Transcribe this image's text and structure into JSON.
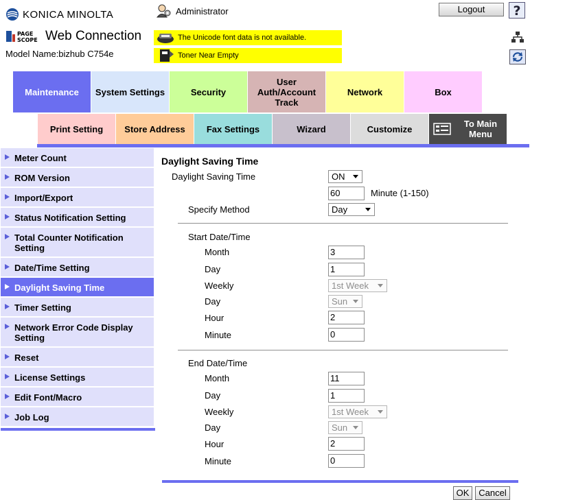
{
  "header": {
    "brand": "KONICA MINOLTA",
    "product": "Web Connection",
    "model_line": "Model Name:bizhub C754e",
    "user": "Administrator",
    "logout_label": "Logout",
    "help_label": "?",
    "messages": [
      "The Unicode font data is not available.",
      "Toner Near Empty"
    ]
  },
  "tabs_row1": [
    {
      "label": "Maintenance",
      "color": "#6b6ef0",
      "active": true
    },
    {
      "label": "System Settings",
      "color": "#d8e6fb"
    },
    {
      "label": "Security",
      "color": "#ccff99"
    },
    {
      "label": "User Auth/Account Track",
      "color": "#d6b4b4"
    },
    {
      "label": "Network",
      "color": "#ffff99"
    },
    {
      "label": "Box",
      "color": "#ffccff"
    }
  ],
  "tabs_row2": [
    {
      "label": "Print Setting",
      "color": "#ffcccc"
    },
    {
      "label": "Store Address",
      "color": "#ffcc99"
    },
    {
      "label": "Fax Settings",
      "color": "#99dddd"
    },
    {
      "label": "Wizard",
      "color": "#c8c0cc"
    },
    {
      "label": "Customize",
      "color": "#dcdcdc"
    },
    {
      "label": "To Main Menu",
      "color": "#4a4a4a"
    }
  ],
  "sidebar": {
    "items": [
      {
        "label": "Meter Count"
      },
      {
        "label": "ROM Version"
      },
      {
        "label": "Import/Export"
      },
      {
        "label": "Status Notification Setting"
      },
      {
        "label": "Total Counter Notification Setting"
      },
      {
        "label": "Date/Time Setting"
      },
      {
        "label": "Daylight Saving Time",
        "active": true
      },
      {
        "label": "Timer Setting"
      },
      {
        "label": "Network Error Code Display Setting"
      },
      {
        "label": "Reset"
      },
      {
        "label": "License Settings"
      },
      {
        "label": "Edit Font/Macro"
      },
      {
        "label": "Job Log"
      }
    ]
  },
  "form": {
    "title": "Daylight Saving Time",
    "dst_label": "Daylight Saving Time",
    "dst_value": "ON",
    "offset_value": "60",
    "offset_unit": "Minute (1-150)",
    "method_label": "Specify Method",
    "method_value": "Day",
    "start_heading": "Start Date/Time",
    "end_heading": "End Date/Time",
    "labels": {
      "month": "Month",
      "day": "Day",
      "weekly": "Weekly",
      "day2": "Day",
      "hour": "Hour",
      "minute": "Minute"
    },
    "start": {
      "month": "3",
      "day": "1",
      "weekly": "1st Week",
      "weekday": "Sun",
      "hour": "2",
      "minute": "0"
    },
    "end": {
      "month": "11",
      "day": "1",
      "weekly": "1st Week",
      "weekday": "Sun",
      "hour": "2",
      "minute": "0"
    },
    "ok_label": "OK",
    "cancel_label": "Cancel"
  },
  "colors": {
    "accent": "#6b6ef0",
    "sidebar_bg": "#e0e0fb",
    "message_bg": "#ffff00"
  }
}
